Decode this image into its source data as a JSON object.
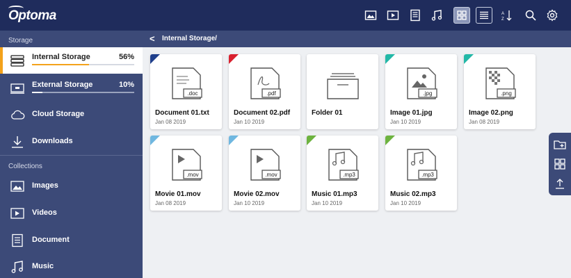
{
  "app": {
    "brand": "Optoma"
  },
  "toolbar": {
    "icons": [
      "image-filter-icon",
      "video-filter-icon",
      "document-filter-icon",
      "music-filter-icon",
      "grid-view-icon",
      "list-view-icon",
      "sort-icon",
      "search-icon",
      "settings-icon"
    ],
    "active_view": "grid"
  },
  "sidebar": {
    "storage_header": "Storage",
    "collections_header": "Collections",
    "storage_items": [
      {
        "label": "Internal Storage",
        "percent": "56%",
        "usage": 0.56,
        "icon": "internal-storage-icon",
        "active": true
      },
      {
        "label": "External Storage",
        "percent": "10%",
        "usage": 0.1,
        "icon": "external-storage-icon",
        "active": false
      },
      {
        "label": "Cloud Storage",
        "icon": "cloud-icon"
      },
      {
        "label": "Downloads",
        "icon": "download-icon"
      }
    ],
    "collection_items": [
      {
        "label": "Images",
        "icon": "image-icon"
      },
      {
        "label": "Videos",
        "icon": "video-icon"
      },
      {
        "label": "Document",
        "icon": "document-icon"
      },
      {
        "label": "Music",
        "icon": "music-icon"
      }
    ]
  },
  "breadcrumb": {
    "back": "<",
    "path": "Internal Storage/"
  },
  "files": [
    {
      "name": "Document 01.txt",
      "date": "Jan 08 2019",
      "ext": ".doc",
      "kind": "doc",
      "color": "#1f3f8c"
    },
    {
      "name": "Document 02.pdf",
      "date": "Jan 10 2019",
      "ext": ".pdf",
      "kind": "pdf",
      "color": "#d9202e"
    },
    {
      "name": "Folder 01",
      "date": "",
      "ext": "",
      "kind": "folder",
      "color": ""
    },
    {
      "name": "Image 01.jpg",
      "date": "Jan 10 2019",
      "ext": ".jpg",
      "kind": "jpg",
      "color": "#22b8a7"
    },
    {
      "name": "Image 02.png",
      "date": "Jan 08 2019",
      "ext": ".png",
      "kind": "png",
      "color": "#22b8a7"
    },
    {
      "name": "Movie 01.mov",
      "date": "Jan 08 2019",
      "ext": ".mov",
      "kind": "mov",
      "color": "#6fb7e0"
    },
    {
      "name": "Movie 02.mov",
      "date": "Jan 10 2019",
      "ext": ".mov",
      "kind": "mov",
      "color": "#6fb7e0"
    },
    {
      "name": "Music 01.mp3",
      "date": "Jan 10 2019",
      "ext": ".mp3",
      "kind": "mp3",
      "color": "#6db33f"
    },
    {
      "name": "Music 02.mp3",
      "date": "Jan 10 2019",
      "ext": ".mp3",
      "kind": "mp3",
      "color": "#6db33f"
    }
  ],
  "side_actions": [
    "new-folder-icon",
    "grid-icon",
    "upload-icon"
  ],
  "colors": {
    "topbar": "#1f2c5c",
    "sidebar": "#3c4a78",
    "accent": "#f3a21b",
    "background": "#eef0f3"
  }
}
